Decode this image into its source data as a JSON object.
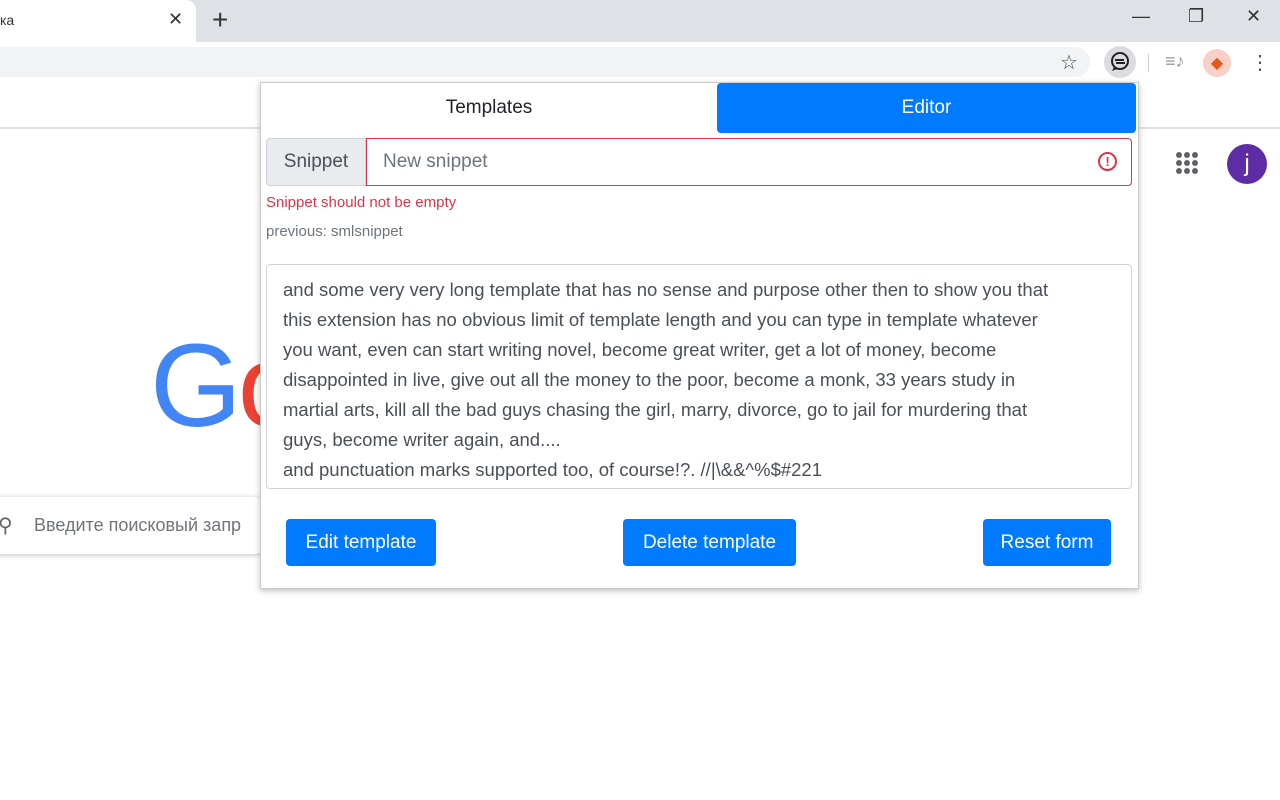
{
  "browser": {
    "tab_title": "ка",
    "close": "✕",
    "new_tab": "+",
    "minimize": "—",
    "restore": "❐",
    "close_window": "✕",
    "star": "☆",
    "media": "≡♪",
    "menu": "⋮"
  },
  "page": {
    "logo": "Go",
    "search_placeholder": "Введите поисковый запр",
    "avatar_letter": "j",
    "search_icon": "search-icon"
  },
  "popup": {
    "tabs": [
      {
        "label": "Templates",
        "active": false
      },
      {
        "label": "Editor",
        "active": true
      }
    ],
    "snippet_label": "Snippet",
    "snippet_value": "",
    "snippet_placeholder": "New snippet",
    "error": "Snippet should not be empty",
    "previous": "previous: smlsnippet",
    "template_lines": [
      "and some very very long template that has no sense and purpose other then to show you that",
      "this extension has no obvious limit of template length and you can type in template whatever",
      "you want, even can start writing novel, become great writer, get a lot of money, become",
      "disappointed in live, give out all the money to the poor, become a monk, 33 years study in",
      "martial arts, kill all the bad guys chasing the girl, marry, divorce, go to jail for murdering that",
      "guys, become writer again, and....",
      "and punctuation marks supported too, of course!?. //|\\&&^%$#221"
    ],
    "buttons": {
      "edit": "Edit template",
      "delete": "Delete template",
      "reset": "Reset form"
    },
    "colors": {
      "primary": "#007bff",
      "danger": "#dc3545"
    }
  }
}
